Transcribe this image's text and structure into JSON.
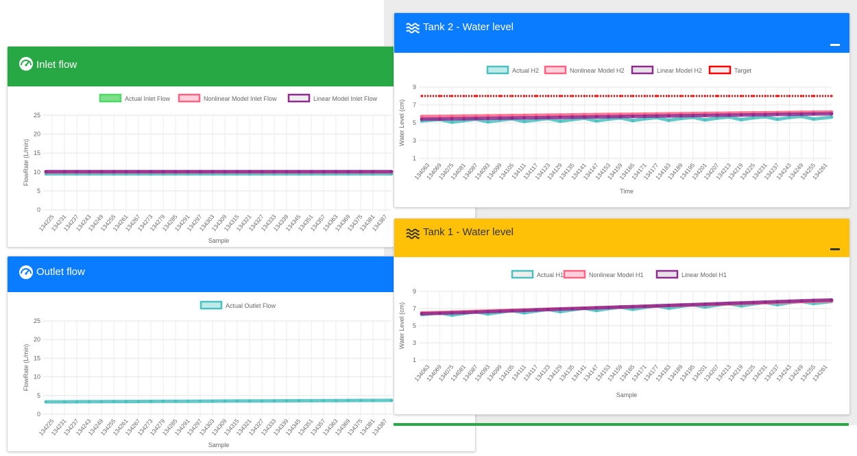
{
  "colors": {
    "green": "#28a745",
    "blue": "#0a7cff",
    "yellow": "#ffc107",
    "teal": "#4bc0c0",
    "pink": "#ff6384",
    "purple": "#8e2b8e",
    "red": "#ff0000"
  },
  "inlet": {
    "title": "Inlet flow",
    "icon": "speedometer-icon"
  },
  "outlet": {
    "title": "Outlet flow",
    "icon": "speedometer-icon"
  },
  "tank2": {
    "title": "Tank 2 - Water level",
    "icon": "water-waves-icon"
  },
  "tank1": {
    "title": "Tank 1 - Water level",
    "icon": "water-waves-icon"
  },
  "chart_data": [
    {
      "id": "inlet",
      "type": "line",
      "xlabel": "Sample",
      "ylabel": "FlowRate (L/min)",
      "ylim": [
        0,
        25
      ],
      "yticks": [
        0,
        5,
        10,
        15,
        20,
        25
      ],
      "grid": true,
      "legend_position": "top",
      "x": [
        "134225",
        "134231",
        "134237",
        "134243",
        "134249",
        "134255",
        "134261",
        "134267",
        "134273",
        "134279",
        "134285",
        "134291",
        "134297",
        "134303",
        "134309",
        "134315",
        "134321",
        "134327",
        "134333",
        "134339",
        "134345",
        "134351",
        "134357",
        "134363",
        "134369",
        "134375",
        "134381",
        "134387"
      ],
      "series": [
        {
          "name": "Actual Inlet Flow",
          "color": "#4bc0c0",
          "fill": "#7ee08a",
          "border": "#4cd964",
          "values_const": 9.5
        },
        {
          "name": "Nonlinear Model Inlet Flow",
          "color": "#ff6384",
          "fill": "#ffd1dc",
          "border": "#ff6384",
          "values_const": 10.0
        },
        {
          "name": "Linear Model Inlet Flow",
          "color": "#8e2b8e",
          "fill": "#eeeeee",
          "border": "#8e2b8e",
          "values_const": 10.1
        }
      ]
    },
    {
      "id": "outlet",
      "type": "line",
      "xlabel": "Sample",
      "ylabel": "FlowRate (L/min)",
      "ylim": [
        0,
        25
      ],
      "yticks": [
        0,
        5,
        10,
        15,
        20,
        25
      ],
      "grid": true,
      "legend_position": "top",
      "x": [
        "134225",
        "134231",
        "134237",
        "134243",
        "134249",
        "134255",
        "134261",
        "134267",
        "134273",
        "134279",
        "134285",
        "134291",
        "134297",
        "134303",
        "134309",
        "134315",
        "134321",
        "134327",
        "134333",
        "134339",
        "134345",
        "134351",
        "134357",
        "134363",
        "134369",
        "134375",
        "134381",
        "134387"
      ],
      "series": [
        {
          "name": "Actual Outlet Flow",
          "color": "#4bc0c0",
          "fill": "#bfeaea",
          "border": "#4bc0c0",
          "values_start": 3.3,
          "values_end": 3.7
        }
      ]
    },
    {
      "id": "tank2",
      "type": "line",
      "xlabel": "Time",
      "ylabel": "Water Level (cm)",
      "ylim": [
        1,
        9
      ],
      "yticks": [
        1,
        3,
        5,
        7,
        9
      ],
      "grid": true,
      "legend_position": "top",
      "x": [
        "134063",
        "134069",
        "134075",
        "134081",
        "134087",
        "134093",
        "134099",
        "134105",
        "134111",
        "134117",
        "134123",
        "134129",
        "134135",
        "134141",
        "134147",
        "134153",
        "134159",
        "134165",
        "134171",
        "134177",
        "134183",
        "134189",
        "134195",
        "134201",
        "134207",
        "134213",
        "134219",
        "134225",
        "134231",
        "134237",
        "134243",
        "134249",
        "134255",
        "134261"
      ],
      "series": [
        {
          "name": "Actual H2",
          "color": "#4bc0c0",
          "fill": "#bfeaea",
          "border": "#4bc0c0",
          "values_start": 5.2,
          "values_end": 5.6,
          "wavy": true
        },
        {
          "name": "Nonlinear Model H2",
          "color": "#ff6384",
          "fill": "#ffd1dc",
          "border": "#ff6384",
          "values_start": 5.7,
          "values_end": 6.2
        },
        {
          "name": "Linear Model H2",
          "color": "#8e2b8e",
          "fill": "#e8e0e8",
          "border": "#8e2b8e",
          "values_start": 5.4,
          "values_end": 6.0
        },
        {
          "name": "Target",
          "color": "#ff0000",
          "fill": "#eeeeee",
          "border": "#ff0000",
          "values_const": 8.0,
          "dotted": true
        }
      ]
    },
    {
      "id": "tank1",
      "type": "line",
      "xlabel": "Sample",
      "ylabel": "Water Level (cm)",
      "ylim": [
        1,
        9
      ],
      "yticks": [
        1,
        3,
        5,
        7,
        9
      ],
      "grid": true,
      "legend_position": "top",
      "x": [
        "134063",
        "134069",
        "134075",
        "134081",
        "134087",
        "134093",
        "134099",
        "134105",
        "134111",
        "134117",
        "134123",
        "134129",
        "134135",
        "134141",
        "134147",
        "134153",
        "134159",
        "134165",
        "134171",
        "134177",
        "134183",
        "134189",
        "134195",
        "134201",
        "134207",
        "134213",
        "134219",
        "134225",
        "134231",
        "134237",
        "134243",
        "134249",
        "134255",
        "134261"
      ],
      "series": [
        {
          "name": "Actual H1",
          "color": "#4bc0c0",
          "fill": "#eeeeee",
          "border": "#4bc0c0",
          "values_start": 6.3,
          "values_end": 7.8,
          "wavy": true
        },
        {
          "name": "Nonlinear Model H1",
          "color": "#ff6384",
          "fill": "#ffd1dc",
          "border": "#ff6384",
          "values_start": 6.5,
          "values_end": 7.9
        },
        {
          "name": "Linear Model H1",
          "color": "#8e2b8e",
          "fill": "#e8e0e8",
          "border": "#8e2b8e",
          "values_start": 6.4,
          "values_end": 8.0
        }
      ]
    }
  ]
}
